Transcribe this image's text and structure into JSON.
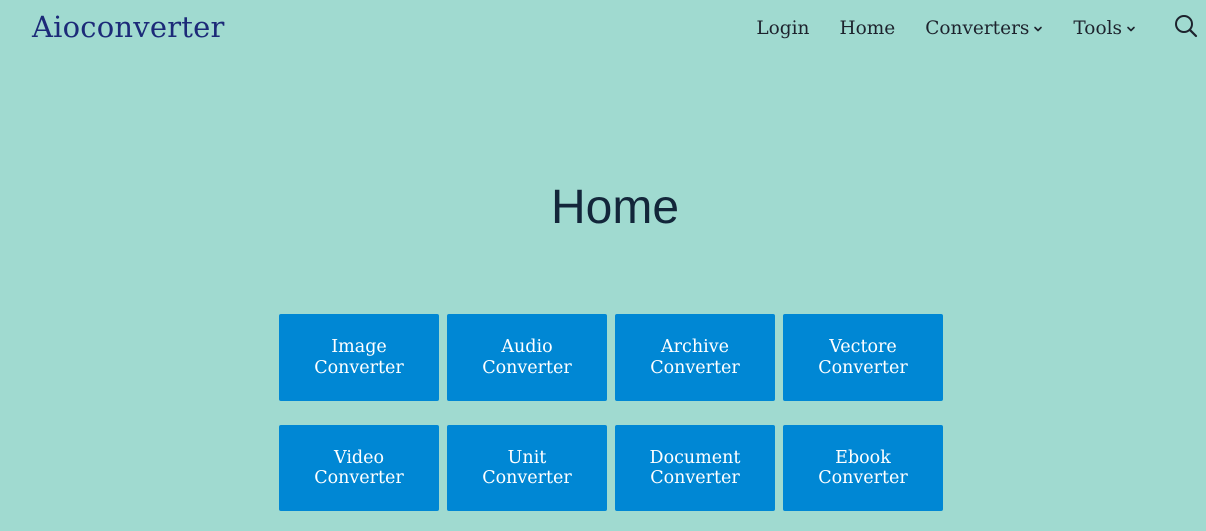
{
  "header": {
    "site_title": "Aioconverter",
    "nav": [
      {
        "label": "Login",
        "has_dropdown": false
      },
      {
        "label": "Home",
        "has_dropdown": false
      },
      {
        "label": "Converters",
        "has_dropdown": true
      },
      {
        "label": "Tools",
        "has_dropdown": true
      }
    ],
    "search_icon": "search-icon"
  },
  "main": {
    "title": "Home",
    "tiles": [
      {
        "line1": "Image",
        "line2": "Converter"
      },
      {
        "line1": "Audio",
        "line2": "Converter"
      },
      {
        "line1": "Archive",
        "line2": "Converter"
      },
      {
        "line1": "Vectore",
        "line2": "Converter"
      },
      {
        "line1": "Video",
        "line2": "Converter"
      },
      {
        "line1": "Unit",
        "line2": "Converter"
      },
      {
        "line1": "Document",
        "line2": "Converter"
      },
      {
        "line1": "Ebook",
        "line2": "Converter"
      }
    ]
  },
  "colors": {
    "background": "#a0dad0",
    "site_title": "#1c2a78",
    "tile_background": "#0087d4",
    "tile_text": "#ffffff",
    "heading": "#13263a"
  }
}
